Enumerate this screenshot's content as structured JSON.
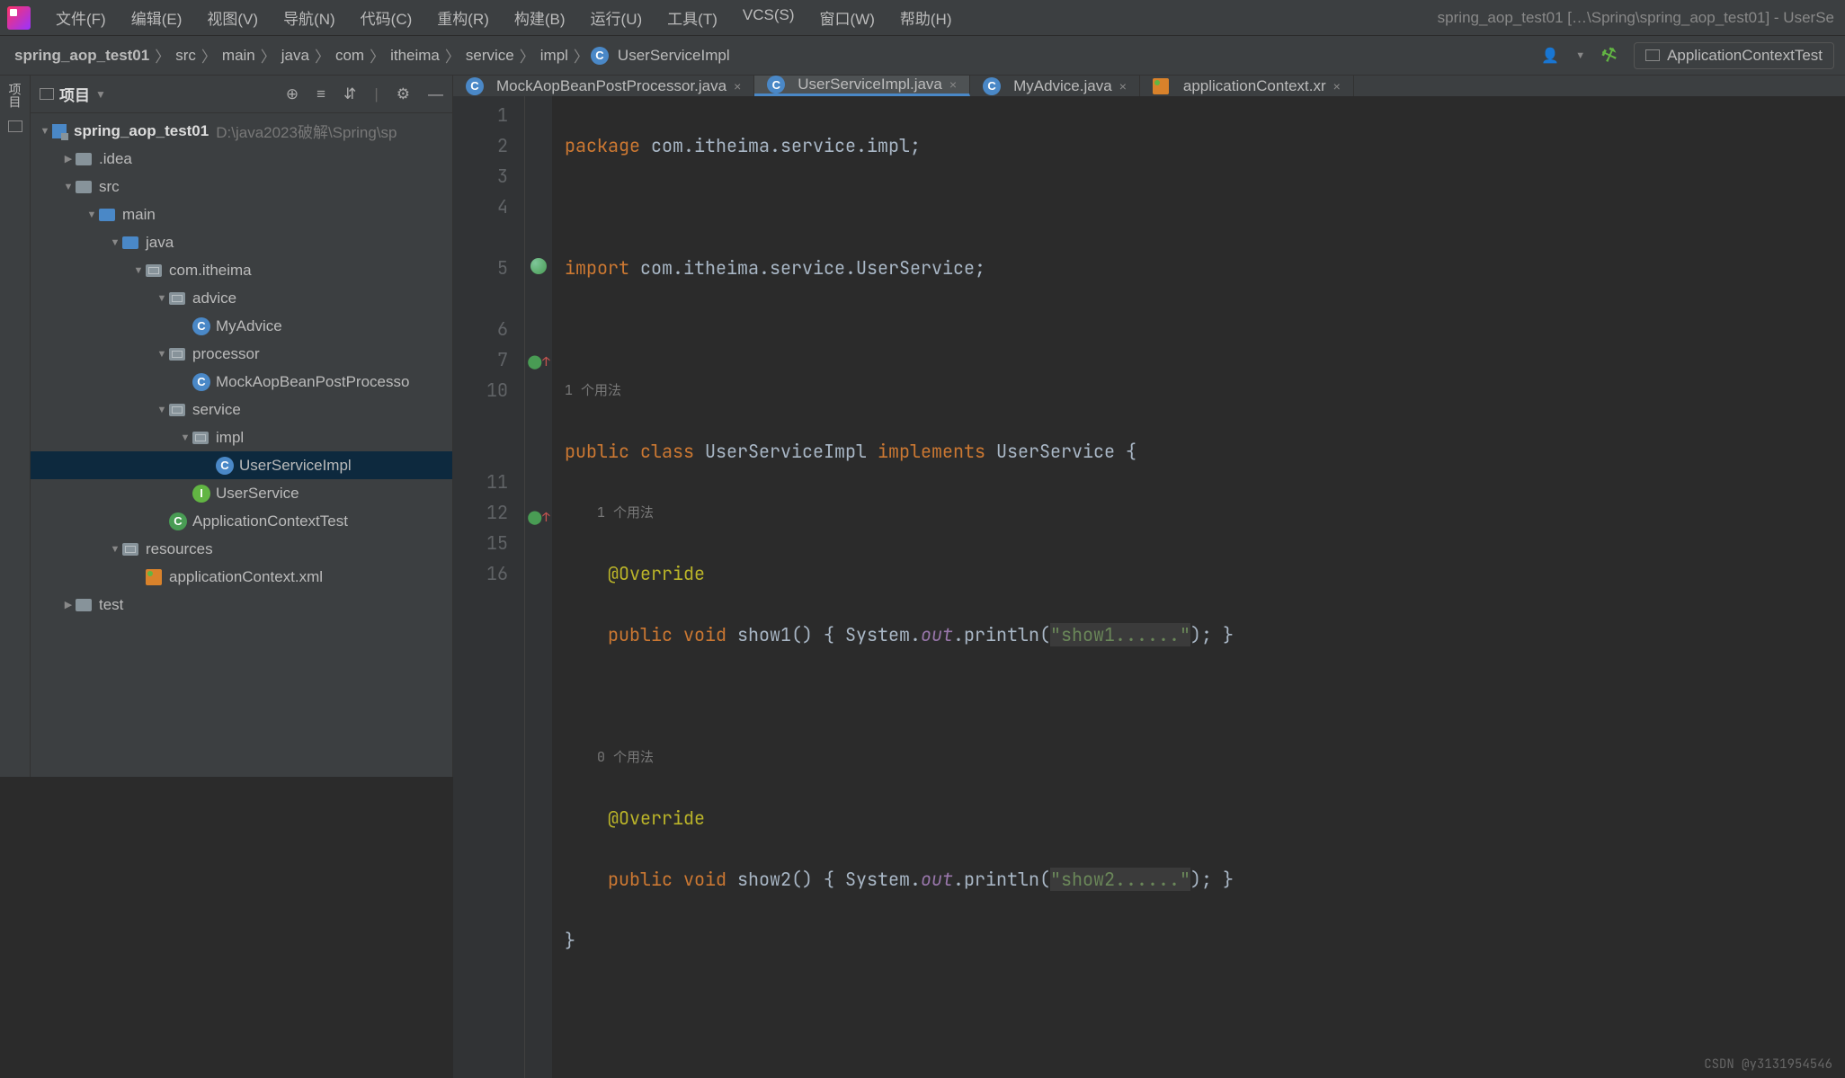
{
  "menu": [
    "文件(F)",
    "编辑(E)",
    "视图(V)",
    "导航(N)",
    "代码(C)",
    "重构(R)",
    "构建(B)",
    "运行(U)",
    "工具(T)",
    "VCS(S)",
    "窗口(W)",
    "帮助(H)"
  ],
  "window_title": "spring_aop_test01 […\\Spring\\spring_aop_test01] - UserSe",
  "breadcrumbs": [
    "spring_aop_test01",
    "src",
    "main",
    "java",
    "com",
    "itheima",
    "service",
    "impl",
    "UserServiceImpl"
  ],
  "run_config": "ApplicationContextTest",
  "leftbar": {
    "project": "项目"
  },
  "sidebar": {
    "title": "项目",
    "root": {
      "name": "spring_aop_test01",
      "path": "D:\\java2023破解\\Spring\\sp"
    },
    "tree": [
      {
        "indent": 1,
        "exp": "▶",
        "icon": "folder",
        "label": ".idea"
      },
      {
        "indent": 1,
        "exp": "▼",
        "icon": "folder",
        "label": "src"
      },
      {
        "indent": 2,
        "exp": "▼",
        "icon": "folder-blue",
        "label": "main"
      },
      {
        "indent": 3,
        "exp": "▼",
        "icon": "folder-blue",
        "label": "java"
      },
      {
        "indent": 4,
        "exp": "▼",
        "icon": "pkg",
        "label": "com.itheima"
      },
      {
        "indent": 5,
        "exp": "▼",
        "icon": "pkg",
        "label": "advice"
      },
      {
        "indent": 6,
        "exp": "",
        "icon": "class",
        "label": "MyAdvice"
      },
      {
        "indent": 5,
        "exp": "▼",
        "icon": "pkg",
        "label": "processor"
      },
      {
        "indent": 6,
        "exp": "",
        "icon": "class",
        "label": "MockAopBeanPostProcesso"
      },
      {
        "indent": 5,
        "exp": "▼",
        "icon": "pkg",
        "label": "service"
      },
      {
        "indent": 6,
        "exp": "▼",
        "icon": "pkg",
        "label": "impl"
      },
      {
        "indent": 7,
        "exp": "",
        "icon": "class",
        "label": "UserServiceImpl",
        "selected": true
      },
      {
        "indent": 6,
        "exp": "",
        "icon": "interface",
        "label": "UserService"
      },
      {
        "indent": 5,
        "exp": "",
        "icon": "class-g",
        "label": "ApplicationContextTest"
      },
      {
        "indent": 3,
        "exp": "▼",
        "icon": "res",
        "label": "resources"
      },
      {
        "indent": 4,
        "exp": "",
        "icon": "xml",
        "label": "applicationContext.xml"
      },
      {
        "indent": 1,
        "exp": "▶",
        "icon": "folder",
        "label": "test"
      }
    ]
  },
  "tabs": [
    {
      "icon": "class",
      "label": "MockAopBeanPostProcessor.java"
    },
    {
      "icon": "class",
      "label": "UserServiceImpl.java",
      "active": true
    },
    {
      "icon": "class",
      "label": "MyAdvice.java"
    },
    {
      "icon": "xml",
      "label": "applicationContext.xr"
    }
  ],
  "gutter_lines": [
    "1",
    "2",
    "3",
    "4",
    "",
    "5",
    "",
    "6",
    "7",
    "10",
    "",
    "",
    "11",
    "12",
    "15",
    "16"
  ],
  "gutter_marks": [
    "",
    "",
    "",
    "",
    "",
    "spring",
    "",
    "",
    "impl-up",
    "",
    "",
    "",
    "",
    "impl-up",
    "",
    ""
  ],
  "code": {
    "l1": {
      "kw": "package",
      "rest": " com.itheima.service.impl;"
    },
    "l3": {
      "kw": "import",
      "rest": " com.itheima.service.UserService;"
    },
    "u1": "1 个用法",
    "l5": {
      "kw1": "public",
      "kw2": "class",
      "name": "UserServiceImpl",
      "kw3": "implements",
      "iface": "UserService",
      "brace": " {"
    },
    "u2": "1 个用法",
    "ann": "@Override",
    "l7": {
      "kw1": "public",
      "kw2": "void",
      "fn": "show1",
      "body1": "() { System.",
      "fld": "out",
      "body2": ".println(",
      "str": "\"show1......\"",
      "body3": "); }"
    },
    "u3": "0 个用法",
    "l12": {
      "kw1": "public",
      "kw2": "void",
      "fn": "show2",
      "body1": "() { System.",
      "fld": "out",
      "body2": ".println(",
      "str": "\"show2......\"",
      "body3": "); }"
    },
    "l15": "}"
  },
  "watermark": "CSDN @y3131954546"
}
